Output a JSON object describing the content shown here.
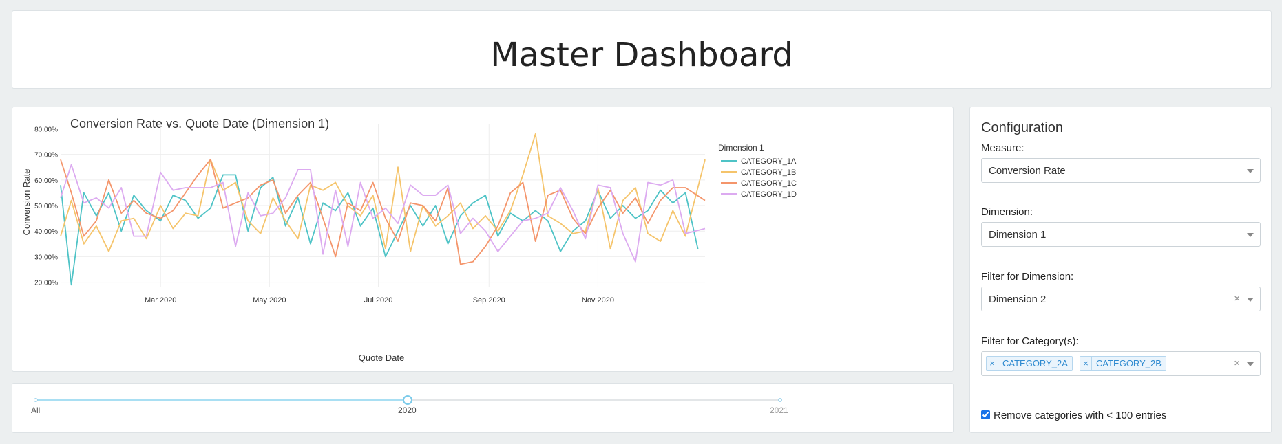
{
  "header": {
    "title": "Master Dashboard"
  },
  "chart_data": {
    "type": "line",
    "title": "Conversion Rate vs. Quote Date (Dimension 1)",
    "xlabel": "Quote Date",
    "ylabel": "Conversion Rate",
    "x_range": [
      "2020-01-05",
      "2020-12-31"
    ],
    "ylim": [
      0.18,
      0.82
    ],
    "y_ticks": [
      0.2,
      0.3,
      0.4,
      0.5,
      0.6,
      0.7,
      0.8
    ],
    "y_tick_labels": [
      "20.00%",
      "30.00%",
      "40.00%",
      "50.00%",
      "60.00%",
      "70.00%",
      "80.00%"
    ],
    "x_ticks": [
      "2020-03-01",
      "2020-05-01",
      "2020-07-01",
      "2020-09-01",
      "2020-11-01"
    ],
    "x_tick_labels": [
      "Mar 2020",
      "May 2020",
      "Jul 2020",
      "Sep 2020",
      "Nov 2020"
    ],
    "grid": true,
    "legend_title": "Dimension 1",
    "legend_position": "right",
    "series": [
      {
        "name": "CATEGORY_1A",
        "color": "#4ec3c6",
        "points": [
          [
            "2020-01-05",
            0.58
          ],
          [
            "2020-01-11",
            0.19
          ],
          [
            "2020-01-18",
            0.55
          ],
          [
            "2020-01-25",
            0.46
          ],
          [
            "2020-02-01",
            0.55
          ],
          [
            "2020-02-08",
            0.4
          ],
          [
            "2020-02-15",
            0.54
          ],
          [
            "2020-02-22",
            0.48
          ],
          [
            "2020-03-01",
            0.44
          ],
          [
            "2020-03-08",
            0.54
          ],
          [
            "2020-03-15",
            0.52
          ],
          [
            "2020-03-22",
            0.45
          ],
          [
            "2020-03-29",
            0.49
          ],
          [
            "2020-04-05",
            0.62
          ],
          [
            "2020-04-12",
            0.62
          ],
          [
            "2020-04-19",
            0.4
          ],
          [
            "2020-04-26",
            0.57
          ],
          [
            "2020-05-03",
            0.61
          ],
          [
            "2020-05-10",
            0.42
          ],
          [
            "2020-05-17",
            0.53
          ],
          [
            "2020-05-24",
            0.35
          ],
          [
            "2020-05-31",
            0.51
          ],
          [
            "2020-06-07",
            0.48
          ],
          [
            "2020-06-14",
            0.55
          ],
          [
            "2020-06-21",
            0.42
          ],
          [
            "2020-06-28",
            0.49
          ],
          [
            "2020-07-05",
            0.3
          ],
          [
            "2020-07-12",
            0.4
          ],
          [
            "2020-07-19",
            0.5
          ],
          [
            "2020-07-26",
            0.42
          ],
          [
            "2020-08-02",
            0.5
          ],
          [
            "2020-08-09",
            0.35
          ],
          [
            "2020-08-16",
            0.46
          ],
          [
            "2020-08-23",
            0.51
          ],
          [
            "2020-08-30",
            0.54
          ],
          [
            "2020-09-06",
            0.38
          ],
          [
            "2020-09-13",
            0.47
          ],
          [
            "2020-09-20",
            0.44
          ],
          [
            "2020-09-27",
            0.48
          ],
          [
            "2020-10-04",
            0.44
          ],
          [
            "2020-10-11",
            0.32
          ],
          [
            "2020-10-18",
            0.4
          ],
          [
            "2020-10-25",
            0.44
          ],
          [
            "2020-11-01",
            0.56
          ],
          [
            "2020-11-08",
            0.45
          ],
          [
            "2020-11-15",
            0.5
          ],
          [
            "2020-11-22",
            0.45
          ],
          [
            "2020-11-29",
            0.48
          ],
          [
            "2020-12-06",
            0.56
          ],
          [
            "2020-12-13",
            0.51
          ],
          [
            "2020-12-20",
            0.55
          ],
          [
            "2020-12-27",
            0.33
          ]
        ]
      },
      {
        "name": "CATEGORY_1B",
        "color": "#f5c46b",
        "points": [
          [
            "2020-01-05",
            0.38
          ],
          [
            "2020-01-11",
            0.52
          ],
          [
            "2020-01-18",
            0.35
          ],
          [
            "2020-01-25",
            0.42
          ],
          [
            "2020-02-01",
            0.32
          ],
          [
            "2020-02-08",
            0.44
          ],
          [
            "2020-02-15",
            0.45
          ],
          [
            "2020-02-22",
            0.37
          ],
          [
            "2020-03-01",
            0.5
          ],
          [
            "2020-03-08",
            0.41
          ],
          [
            "2020-03-15",
            0.47
          ],
          [
            "2020-03-22",
            0.46
          ],
          [
            "2020-03-29",
            0.68
          ],
          [
            "2020-04-05",
            0.56
          ],
          [
            "2020-04-12",
            0.59
          ],
          [
            "2020-04-19",
            0.44
          ],
          [
            "2020-04-26",
            0.39
          ],
          [
            "2020-05-03",
            0.53
          ],
          [
            "2020-05-10",
            0.44
          ],
          [
            "2020-05-17",
            0.37
          ],
          [
            "2020-05-24",
            0.58
          ],
          [
            "2020-05-31",
            0.56
          ],
          [
            "2020-06-07",
            0.59
          ],
          [
            "2020-06-14",
            0.5
          ],
          [
            "2020-06-21",
            0.46
          ],
          [
            "2020-06-28",
            0.54
          ],
          [
            "2020-07-05",
            0.33
          ],
          [
            "2020-07-12",
            0.65
          ],
          [
            "2020-07-19",
            0.32
          ],
          [
            "2020-07-26",
            0.5
          ],
          [
            "2020-08-02",
            0.42
          ],
          [
            "2020-08-09",
            0.46
          ],
          [
            "2020-08-16",
            0.51
          ],
          [
            "2020-08-23",
            0.41
          ],
          [
            "2020-08-30",
            0.46
          ],
          [
            "2020-09-06",
            0.4
          ],
          [
            "2020-09-13",
            0.48
          ],
          [
            "2020-09-20",
            0.62
          ],
          [
            "2020-09-27",
            0.78
          ],
          [
            "2020-10-04",
            0.46
          ],
          [
            "2020-10-11",
            0.43
          ],
          [
            "2020-10-18",
            0.39
          ],
          [
            "2020-10-25",
            0.4
          ],
          [
            "2020-11-01",
            0.57
          ],
          [
            "2020-11-08",
            0.33
          ],
          [
            "2020-11-15",
            0.52
          ],
          [
            "2020-11-22",
            0.57
          ],
          [
            "2020-11-29",
            0.39
          ],
          [
            "2020-12-06",
            0.36
          ],
          [
            "2020-12-13",
            0.48
          ],
          [
            "2020-12-20",
            0.38
          ],
          [
            "2020-12-31",
            0.68
          ]
        ]
      },
      {
        "name": "CATEGORY_1C",
        "color": "#f4956b",
        "points": [
          [
            "2020-01-05",
            0.68
          ],
          [
            "2020-01-11",
            0.55
          ],
          [
            "2020-01-18",
            0.38
          ],
          [
            "2020-01-25",
            0.44
          ],
          [
            "2020-02-01",
            0.6
          ],
          [
            "2020-02-08",
            0.47
          ],
          [
            "2020-02-15",
            0.52
          ],
          [
            "2020-02-22",
            0.47
          ],
          [
            "2020-03-01",
            0.45
          ],
          [
            "2020-03-08",
            0.48
          ],
          [
            "2020-03-15",
            0.55
          ],
          [
            "2020-03-22",
            0.62
          ],
          [
            "2020-03-29",
            0.68
          ],
          [
            "2020-04-05",
            0.49
          ],
          [
            "2020-04-12",
            0.51
          ],
          [
            "2020-04-19",
            0.53
          ],
          [
            "2020-04-26",
            0.58
          ],
          [
            "2020-05-03",
            0.6
          ],
          [
            "2020-05-10",
            0.47
          ],
          [
            "2020-05-17",
            0.54
          ],
          [
            "2020-05-24",
            0.59
          ],
          [
            "2020-05-31",
            0.45
          ],
          [
            "2020-06-07",
            0.3
          ],
          [
            "2020-06-14",
            0.51
          ],
          [
            "2020-06-21",
            0.48
          ],
          [
            "2020-06-28",
            0.59
          ],
          [
            "2020-07-05",
            0.45
          ],
          [
            "2020-07-12",
            0.36
          ],
          [
            "2020-07-19",
            0.51
          ],
          [
            "2020-07-26",
            0.5
          ],
          [
            "2020-08-02",
            0.44
          ],
          [
            "2020-08-09",
            0.57
          ],
          [
            "2020-08-16",
            0.27
          ],
          [
            "2020-08-23",
            0.28
          ],
          [
            "2020-08-30",
            0.34
          ],
          [
            "2020-09-06",
            0.42
          ],
          [
            "2020-09-13",
            0.55
          ],
          [
            "2020-09-20",
            0.59
          ],
          [
            "2020-09-27",
            0.36
          ],
          [
            "2020-10-04",
            0.54
          ],
          [
            "2020-10-11",
            0.56
          ],
          [
            "2020-10-18",
            0.45
          ],
          [
            "2020-10-25",
            0.39
          ],
          [
            "2020-11-01",
            0.49
          ],
          [
            "2020-11-08",
            0.56
          ],
          [
            "2020-11-15",
            0.47
          ],
          [
            "2020-11-22",
            0.53
          ],
          [
            "2020-11-29",
            0.43
          ],
          [
            "2020-12-06",
            0.52
          ],
          [
            "2020-12-13",
            0.57
          ],
          [
            "2020-12-20",
            0.57
          ],
          [
            "2020-12-31",
            0.52
          ]
        ]
      },
      {
        "name": "CATEGORY_1D",
        "color": "#dcaaf0",
        "points": [
          [
            "2020-01-05",
            0.53
          ],
          [
            "2020-01-11",
            0.66
          ],
          [
            "2020-01-18",
            0.51
          ],
          [
            "2020-01-25",
            0.53
          ],
          [
            "2020-02-01",
            0.49
          ],
          [
            "2020-02-08",
            0.57
          ],
          [
            "2020-02-15",
            0.38
          ],
          [
            "2020-02-22",
            0.38
          ],
          [
            "2020-03-01",
            0.63
          ],
          [
            "2020-03-08",
            0.56
          ],
          [
            "2020-03-15",
            0.57
          ],
          [
            "2020-03-22",
            0.57
          ],
          [
            "2020-03-29",
            0.57
          ],
          [
            "2020-04-05",
            0.59
          ],
          [
            "2020-04-12",
            0.34
          ],
          [
            "2020-04-19",
            0.55
          ],
          [
            "2020-04-26",
            0.46
          ],
          [
            "2020-05-03",
            0.47
          ],
          [
            "2020-05-10",
            0.53
          ],
          [
            "2020-05-17",
            0.64
          ],
          [
            "2020-05-24",
            0.64
          ],
          [
            "2020-05-31",
            0.31
          ],
          [
            "2020-06-07",
            0.56
          ],
          [
            "2020-06-14",
            0.34
          ],
          [
            "2020-06-21",
            0.59
          ],
          [
            "2020-06-28",
            0.45
          ],
          [
            "2020-07-05",
            0.49
          ],
          [
            "2020-07-12",
            0.43
          ],
          [
            "2020-07-19",
            0.58
          ],
          [
            "2020-07-26",
            0.54
          ],
          [
            "2020-08-02",
            0.54
          ],
          [
            "2020-08-09",
            0.58
          ],
          [
            "2020-08-16",
            0.39
          ],
          [
            "2020-08-23",
            0.45
          ],
          [
            "2020-08-30",
            0.4
          ],
          [
            "2020-09-06",
            0.32
          ],
          [
            "2020-09-13",
            0.38
          ],
          [
            "2020-09-20",
            0.44
          ],
          [
            "2020-09-27",
            0.45
          ],
          [
            "2020-10-04",
            0.47
          ],
          [
            "2020-10-11",
            0.57
          ],
          [
            "2020-10-18",
            0.48
          ],
          [
            "2020-10-25",
            0.37
          ],
          [
            "2020-11-01",
            0.58
          ],
          [
            "2020-11-08",
            0.57
          ],
          [
            "2020-11-15",
            0.39
          ],
          [
            "2020-11-22",
            0.28
          ],
          [
            "2020-11-29",
            0.59
          ],
          [
            "2020-12-06",
            0.58
          ],
          [
            "2020-12-13",
            0.6
          ],
          [
            "2020-12-20",
            0.39
          ],
          [
            "2020-12-31",
            0.41
          ]
        ]
      }
    ]
  },
  "slider": {
    "labels": [
      "All",
      "2020",
      "2021"
    ],
    "selected": "2020"
  },
  "config": {
    "title": "Configuration",
    "measure_label": "Measure:",
    "measure_value": "Conversion Rate",
    "dimension_label": "Dimension:",
    "dimension_value": "Dimension 1",
    "filter_dim_label": "Filter for Dimension:",
    "filter_dim_value": "Dimension 2",
    "filter_cat_label": "Filter for Category(s):",
    "filter_cat_values": [
      "CATEGORY_2A",
      "CATEGORY_2B"
    ],
    "remove_label": "Remove categories with < 100 entries",
    "remove_checked": true,
    "tag_remove_glyph": "×",
    "clear_glyph": "×"
  },
  "colors": {
    "accent": "#2e8ad0",
    "slider": "#7ccbea"
  }
}
